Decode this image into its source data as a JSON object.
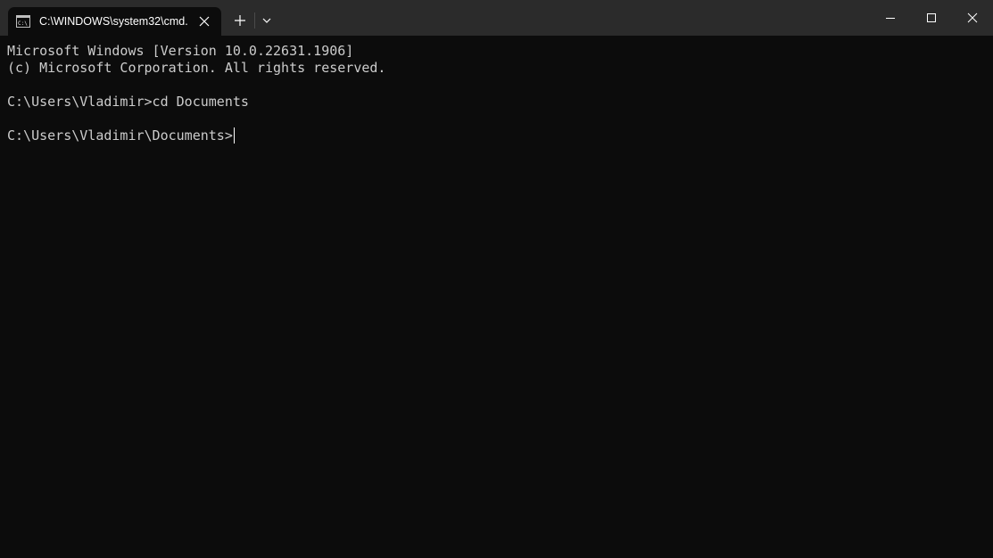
{
  "tab": {
    "title": "C:\\WINDOWS\\system32\\cmd.",
    "icon": "cmd-terminal-icon"
  },
  "toolbar": {
    "new_tab_icon": "plus-icon",
    "dropdown_icon": "chevron-down-icon"
  },
  "caption": {
    "minimize_icon": "minimize-icon",
    "maximize_icon": "maximize-icon",
    "close_icon": "close-icon"
  },
  "terminal": {
    "lines": [
      "Microsoft Windows [Version 10.0.22631.1906]",
      "(c) Microsoft Corporation. All rights reserved.",
      "",
      "C:\\Users\\Vladimir>cd Documents",
      "",
      "C:\\Users\\Vladimir\\Documents>"
    ]
  },
  "colors": {
    "titlebar": "#2b2b2b",
    "background": "#0c0c0c",
    "text": "#cccccc"
  }
}
